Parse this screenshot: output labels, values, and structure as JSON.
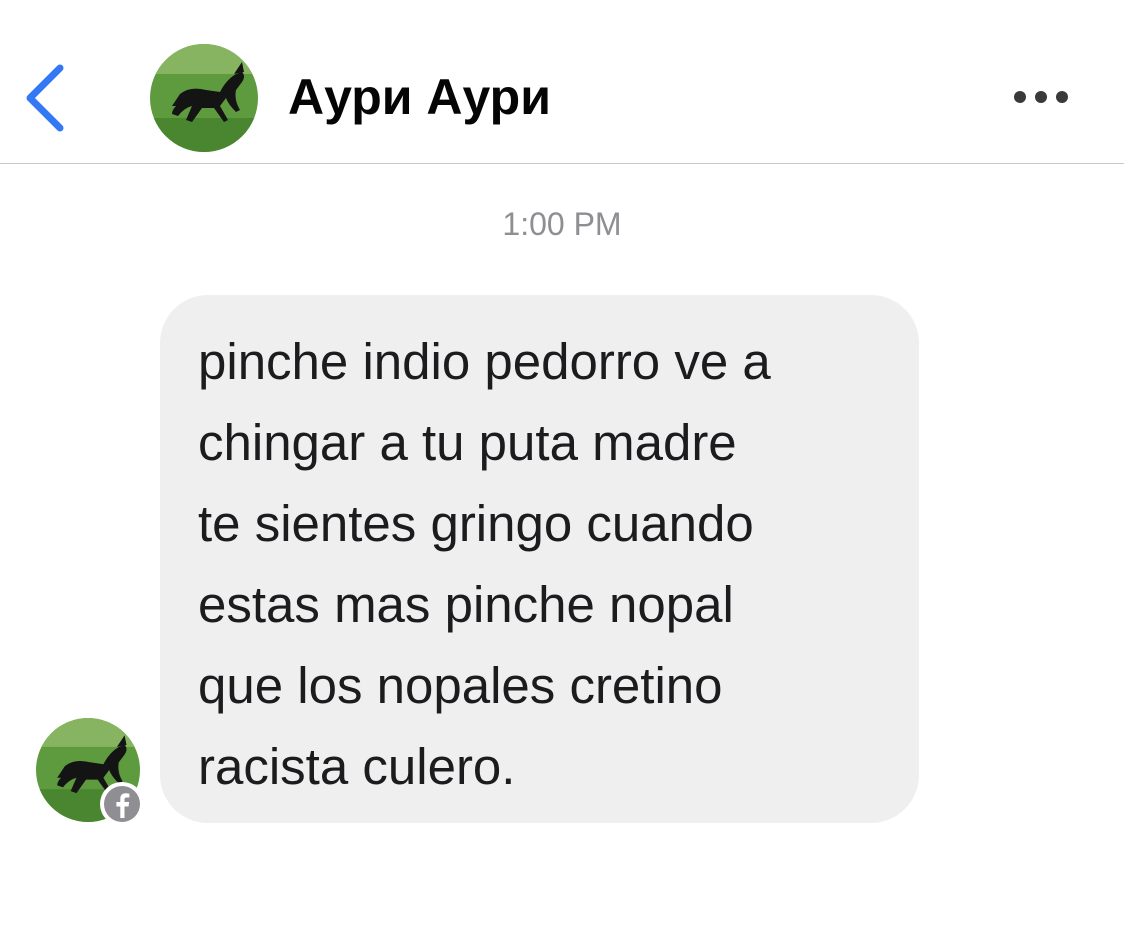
{
  "header": {
    "contact_name": "Аури Аури",
    "back_icon": "chevron-left-icon",
    "more_icon": "more-horizontal-icon",
    "accent_color": "#3478f6"
  },
  "conversation": {
    "timestamp": "1:00 PM",
    "messages": [
      {
        "direction": "incoming",
        "text": "pinche indio pedorro ve a\nchingar a tu puta madre\nte sientes gringo cuando\nestas mas pinche nopal\nque los nopales cretino\nracista culero.",
        "bubble_color": "#f0eff0",
        "sender_badge_icon": "facebook-icon"
      }
    ]
  },
  "avatar": {
    "image": "black-horse-on-grass"
  }
}
